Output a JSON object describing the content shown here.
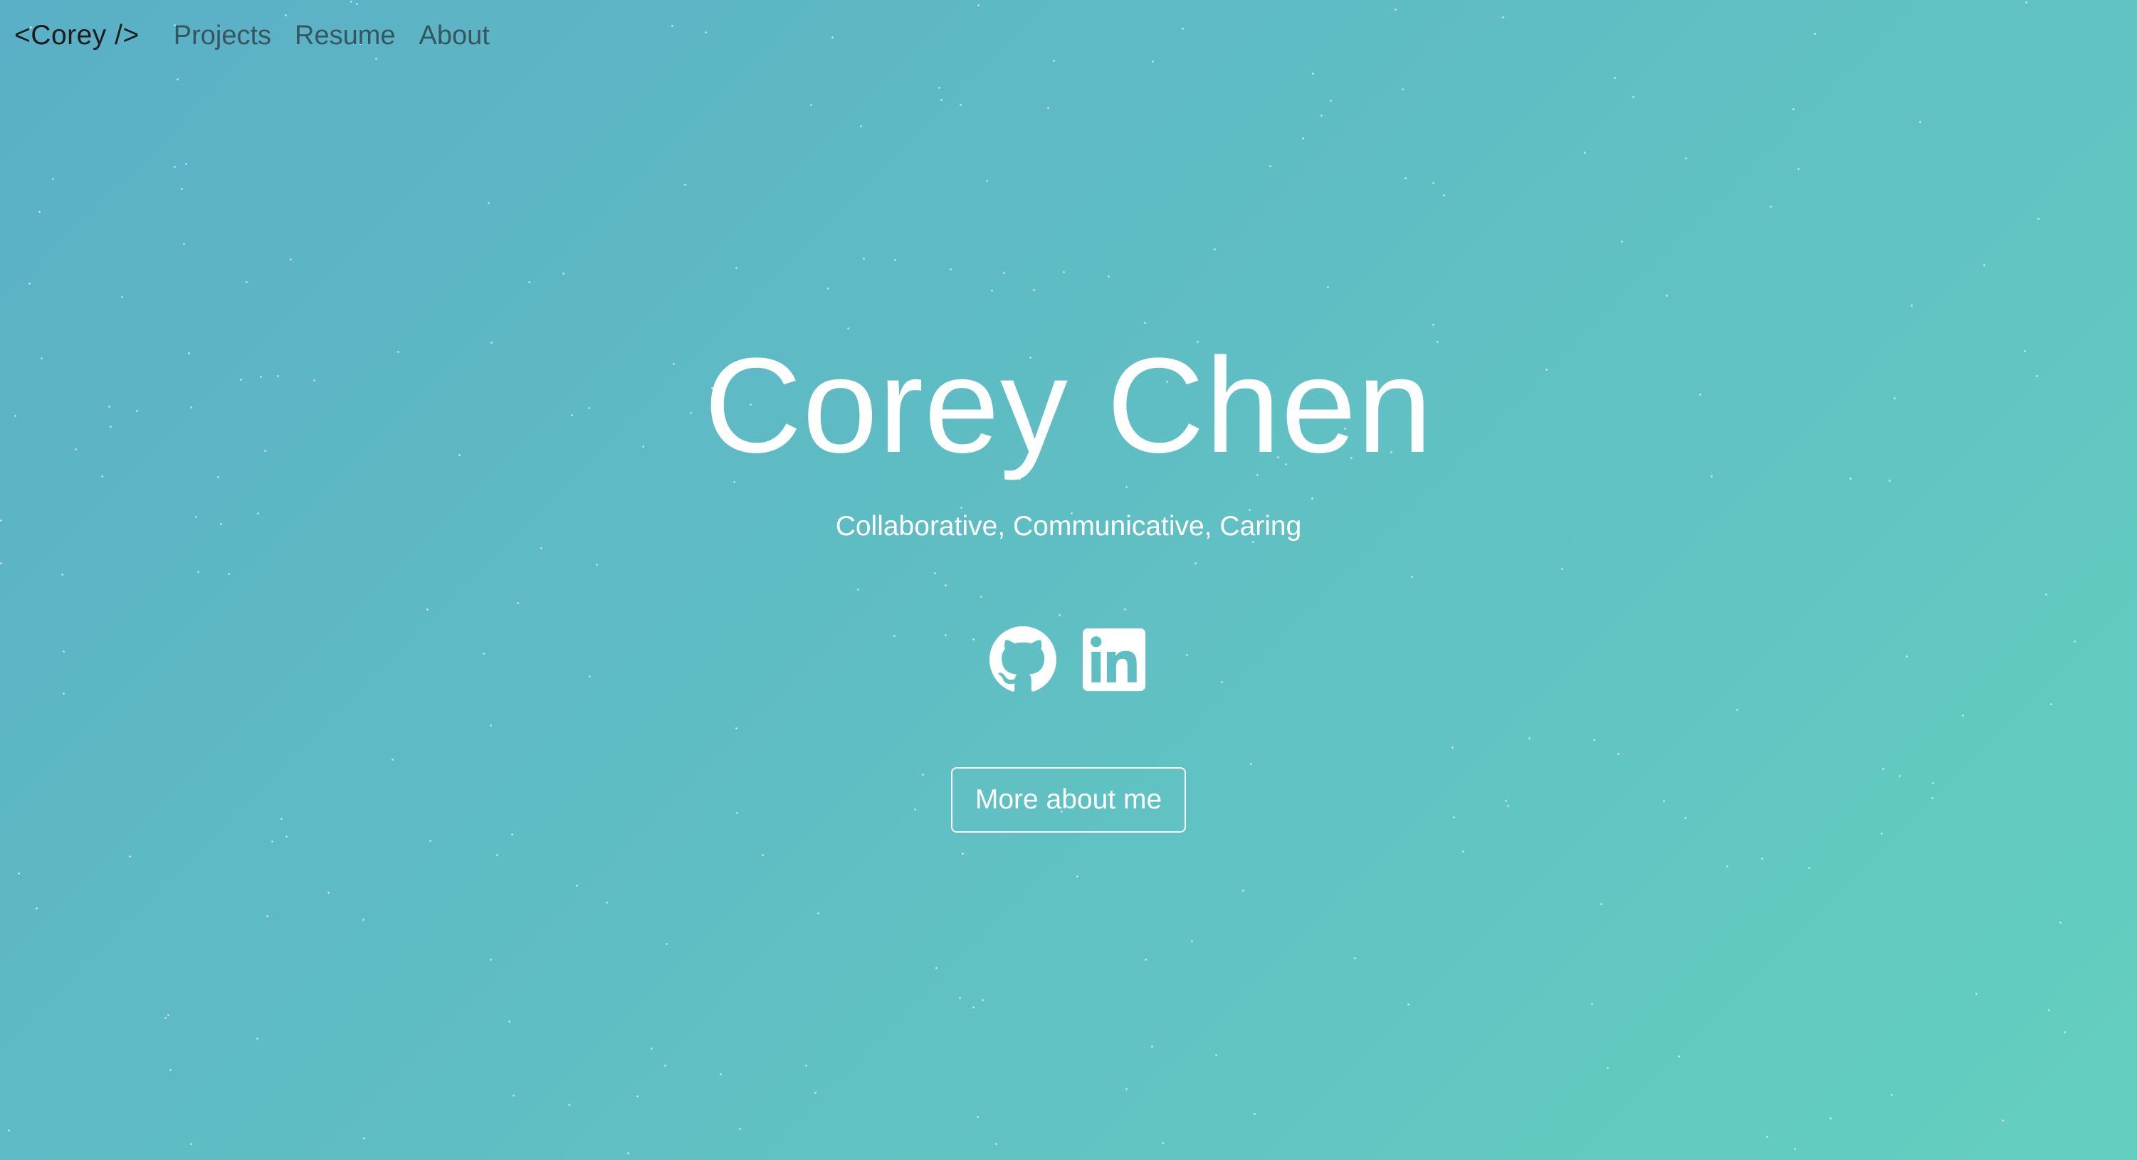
{
  "nav": {
    "brand": "<Corey />",
    "links": [
      {
        "label": "Projects"
      },
      {
        "label": "Resume"
      },
      {
        "label": "About"
      }
    ]
  },
  "hero": {
    "name": "Corey Chen",
    "tagline": "Collaborative, Communicative, Caring",
    "social": [
      {
        "icon": "github-icon"
      },
      {
        "icon": "linkedin-icon"
      }
    ],
    "cta_label": "More about me"
  },
  "colors": {
    "gradient_start": "#5ab0c6",
    "gradient_end": "#64cfc0",
    "text": "#ffffff",
    "brand_text": "#1c1c1c"
  }
}
